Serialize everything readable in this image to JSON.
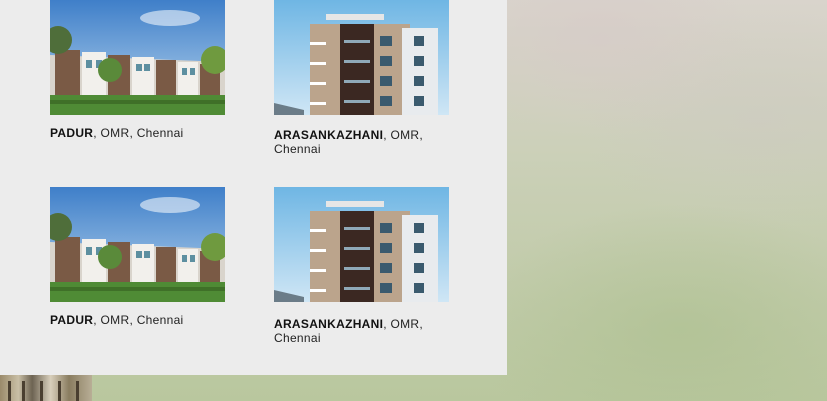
{
  "listings": [
    {
      "name": "PADUR",
      "location": ", OMR, Chennai",
      "image_icon": "townhouse-photo"
    },
    {
      "name": "ARASANKAZHANI",
      "location": ", OMR, Chennai",
      "image_icon": "apartment-photo"
    },
    {
      "name": "PADUR",
      "location": ", OMR, Chennai",
      "image_icon": "townhouse-photo"
    },
    {
      "name": "ARASANKAZHANI",
      "location": ", OMR, Chennai",
      "image_icon": "apartment-photo"
    }
  ]
}
